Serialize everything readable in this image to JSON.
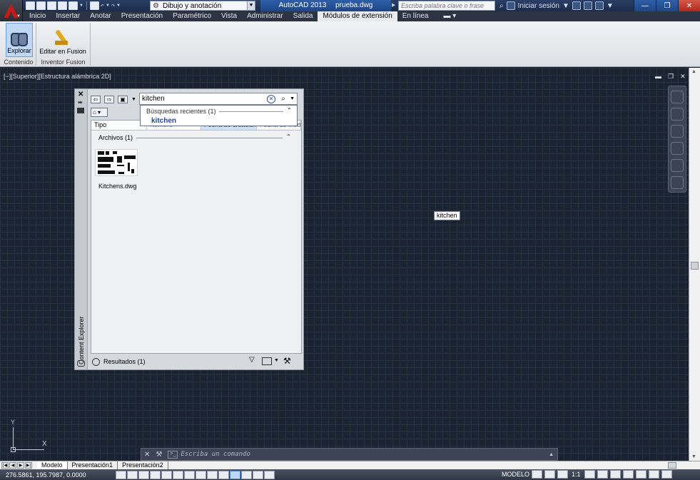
{
  "title_bar": {
    "workspace": "Dibujo y anotación",
    "app_name": "AutoCAD 2013",
    "file_name": "prueba.dwg",
    "search_placeholder": "Escriba palabra clave o frase",
    "sign_in": "Iniciar sesión"
  },
  "ribbon": {
    "tabs": [
      "Inicio",
      "Insertar",
      "Anotar",
      "Presentación",
      "Paramétrico",
      "Vista",
      "Administrar",
      "Salida",
      "Módulos de extensión",
      "En línea"
    ],
    "active_tab": "Módulos de extensión",
    "buttons": {
      "explore": "Explorar",
      "edit_fusion": "Editar en Fusion"
    },
    "panels": [
      "Contenido",
      "Inventor Fusion"
    ]
  },
  "viewport": {
    "label": "[−][Superior][Estructura alámbrica 2D]",
    "tooltip": "kitchen",
    "ucs_x": "X",
    "ucs_y": "Y"
  },
  "content_explorer": {
    "title": "Content Explorer",
    "search_value": "kitchen",
    "recent": {
      "header": "Búsquedas recientes (1)",
      "items": [
        "kitchen"
      ]
    },
    "columns": [
      "Tipo",
      "Nombre",
      "Fecha de creación",
      "Fecha de mod"
    ],
    "group": "Archivos (1)",
    "files": [
      {
        "name": "Kitchens.dwg"
      }
    ],
    "footer": "Resultados (1)"
  },
  "command_line": {
    "placeholder": "Escriba un comando"
  },
  "layout_tabs": [
    "Modelo",
    "Presentación1",
    "Presentación2"
  ],
  "active_layout": "Modelo",
  "status_bar": {
    "coordinates": "276.5861, 195.7987, 0.0000",
    "space": "MODELO",
    "scale": "1:1"
  },
  "colors": {
    "canvas": "#1c2330",
    "title_bar": "#1f4687",
    "accent": "#23449a"
  }
}
